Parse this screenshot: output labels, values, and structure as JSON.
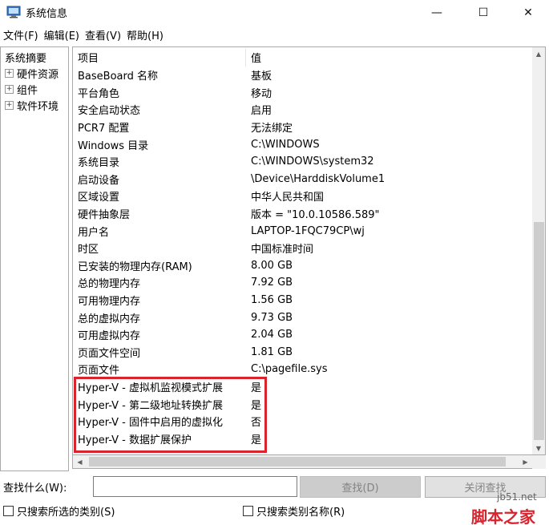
{
  "window": {
    "title": "系统信息",
    "minimize_glyph": "—",
    "maximize_glyph": "☐",
    "close_glyph": "✕"
  },
  "menu": [
    "文件(F)",
    "编辑(E)",
    "查看(V)",
    "帮助(H)"
  ],
  "tree": {
    "root": "系统摘要",
    "children": [
      "硬件资源",
      "组件",
      "软件环境"
    ],
    "expander_glyph": "+"
  },
  "list": {
    "header": {
      "item": "项目",
      "value": "值"
    },
    "rows": [
      {
        "item": "BaseBoard 名称",
        "value": "基板"
      },
      {
        "item": "平台角色",
        "value": "移动"
      },
      {
        "item": "安全启动状态",
        "value": "启用"
      },
      {
        "item": "PCR7 配置",
        "value": "无法绑定"
      },
      {
        "item": "Windows 目录",
        "value": "C:\\WINDOWS"
      },
      {
        "item": "系统目录",
        "value": "C:\\WINDOWS\\system32"
      },
      {
        "item": "启动设备",
        "value": "\\Device\\HarddiskVolume1"
      },
      {
        "item": "区域设置",
        "value": "中华人民共和国"
      },
      {
        "item": "硬件抽象层",
        "value": "版本 = \"10.0.10586.589\""
      },
      {
        "item": "用户名",
        "value": "LAPTOP-1FQC79CP\\wj"
      },
      {
        "item": "时区",
        "value": "中国标准时间"
      },
      {
        "item": "已安装的物理内存(RAM)",
        "value": "8.00 GB"
      },
      {
        "item": "总的物理内存",
        "value": "7.92 GB"
      },
      {
        "item": "可用物理内存",
        "value": "1.56 GB"
      },
      {
        "item": "总的虚拟内存",
        "value": "9.73 GB"
      },
      {
        "item": "可用虚拟内存",
        "value": "2.04 GB"
      },
      {
        "item": "页面文件空间",
        "value": "1.81 GB"
      },
      {
        "item": "页面文件",
        "value": "C:\\pagefile.sys"
      },
      {
        "item": "Hyper-V - 虚拟机监视模式扩展",
        "value": "是"
      },
      {
        "item": "Hyper-V - 第二级地址转换扩展",
        "value": "是"
      },
      {
        "item": "Hyper-V - 固件中启用的虚拟化",
        "value": "否"
      },
      {
        "item": "Hyper-V - 数据扩展保护",
        "value": "是"
      }
    ]
  },
  "scrollbar": {
    "up": "▲",
    "down": "▼",
    "left": "◀",
    "right": "▶"
  },
  "search": {
    "label": "查找什么(W):",
    "value": "",
    "find_button": "查找(D)",
    "close_button": "关闭查找",
    "checkbox1": "只搜索所选的类别(S)",
    "checkbox2": "只搜索类别名称(R)"
  },
  "watermark": {
    "line1": "jb51.net",
    "line2": "脚本之家"
  },
  "colors": {
    "highlight": "#d9232d",
    "watermark": "#d9232d"
  }
}
